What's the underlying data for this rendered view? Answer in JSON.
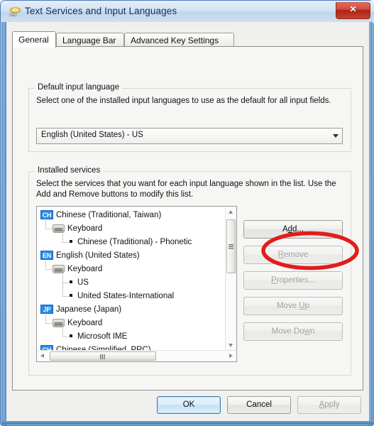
{
  "window": {
    "title": "Text Services and Input Languages",
    "icon": "language-icon",
    "close_label": "✕"
  },
  "tabs": [
    {
      "id": "general",
      "label": "General",
      "active": true
    },
    {
      "id": "language-bar",
      "label": "Language Bar",
      "active": false
    },
    {
      "id": "advanced-keys",
      "label": "Advanced Key Settings",
      "active": false
    }
  ],
  "default_input_language": {
    "group_title": "Default input language",
    "description": "Select one of the installed input languages to use as the default for all input fields.",
    "selected": "English (United States) - US",
    "options": [
      "English (United States) - US"
    ]
  },
  "installed_services": {
    "group_title": "Installed services",
    "description": "Select the services that you want for each input language shown in the list. Use the Add and Remove buttons to modify this list.",
    "tree": [
      {
        "level": "lang",
        "badge": "CH",
        "label": "Chinese (Traditional, Taiwan)"
      },
      {
        "level": "kbd",
        "badge": "",
        "label": "Keyboard"
      },
      {
        "level": "svc",
        "badge": "",
        "label": "Chinese (Traditional) - Phonetic"
      },
      {
        "level": "lang",
        "badge": "EN",
        "label": "English (United States)"
      },
      {
        "level": "kbd",
        "badge": "",
        "label": "Keyboard"
      },
      {
        "level": "svc",
        "badge": "",
        "label": "US"
      },
      {
        "level": "svc",
        "badge": "",
        "label": "United States-International"
      },
      {
        "level": "lang",
        "badge": "JP",
        "label": "Japanese (Japan)"
      },
      {
        "level": "kbd",
        "badge": "",
        "label": "Keyboard"
      },
      {
        "level": "svc",
        "badge": "",
        "label": "Microsoft IME"
      },
      {
        "level": "lang",
        "badge": "CH",
        "label": "Chinese (Simplified, PRC)"
      }
    ],
    "buttons": [
      {
        "id": "add",
        "label": "Add...",
        "accel": "d",
        "enabled": true,
        "highlighted": true
      },
      {
        "id": "remove",
        "label": "Remove",
        "accel": "R",
        "enabled": false,
        "highlighted": false
      },
      {
        "id": "properties",
        "label": "Properties...",
        "accel": "P",
        "enabled": false,
        "highlighted": false
      },
      {
        "id": "moveup",
        "label": "Move Up",
        "accel": "U",
        "enabled": false,
        "highlighted": false
      },
      {
        "id": "movedown",
        "label": "Move Down",
        "accel": "w",
        "enabled": false,
        "highlighted": false
      }
    ]
  },
  "dialog_buttons": [
    {
      "id": "ok",
      "label": "OK",
      "enabled": true,
      "default": true
    },
    {
      "id": "cancel",
      "label": "Cancel",
      "enabled": true,
      "default": false
    },
    {
      "id": "apply",
      "label": "Apply",
      "enabled": false,
      "default": false
    }
  ],
  "annotation": {
    "type": "ellipse",
    "color": "#e31c1c",
    "target": "Add..."
  },
  "colors": {
    "accent": "#2a8ae8",
    "annotation_red": "#e31c1c",
    "window_frame": "#4a7ab5",
    "dialog_bg": "#f0f0ef",
    "close_red": "#c4442f"
  }
}
